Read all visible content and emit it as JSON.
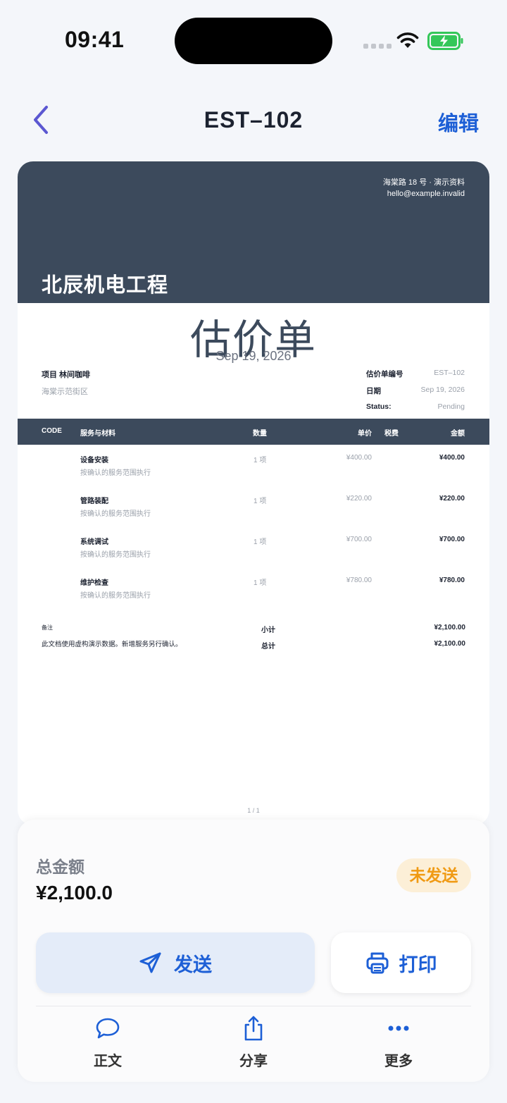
{
  "status": {
    "time": "09:41"
  },
  "nav": {
    "title": "EST–102",
    "edit_label": "编辑"
  },
  "document": {
    "address_line": "海棠路 18 号 · 演示资料",
    "email": "hello@example.invalid",
    "company": "北辰机电工程",
    "type_title": "估价单",
    "date": "Sep 19, 2026",
    "project_label": "项目 林间咖啡",
    "project_address": "海棠示范街区",
    "meta": [
      {
        "key": "估价单编号",
        "value": "EST–102"
      },
      {
        "key": "日期",
        "value": "Sep 19, 2026"
      },
      {
        "key": "Status:",
        "value": "Pending"
      }
    ],
    "columns": {
      "code": "CODE",
      "service": "服务与材料",
      "qty": "数量",
      "price": "单价",
      "tax": "税费",
      "amount": "金额"
    },
    "items": [
      {
        "name": "设备安装",
        "desc": "按确认的服务范围执行",
        "qty": "1 项",
        "price": "¥400.00",
        "amount": "¥400.00"
      },
      {
        "name": "管路装配",
        "desc": "按确认的服务范围执行",
        "qty": "1 项",
        "price": "¥220.00",
        "amount": "¥220.00"
      },
      {
        "name": "系统调试",
        "desc": "按确认的服务范围执行",
        "qty": "1 项",
        "price": "¥700.00",
        "amount": "¥700.00"
      },
      {
        "name": "维护检查",
        "desc": "按确认的服务范围执行",
        "qty": "1 项",
        "price": "¥780.00",
        "amount": "¥780.00"
      }
    ],
    "notes_label": "备注",
    "notes_text": "此文档使用虚构演示数据。新增服务另行确认。",
    "subtotal_label": "小计",
    "subtotal_value": "¥2,100.00",
    "total_label": "总计",
    "total_value": "¥2,100.00",
    "page": "1 / 1"
  },
  "panel": {
    "total_label": "总金额",
    "total_value": "¥2,100.0",
    "status_badge": "未发送",
    "send_label": "发送",
    "print_label": "打印",
    "tabs": [
      {
        "label": "正文",
        "icon": "chat-bubble-icon"
      },
      {
        "label": "分享",
        "icon": "share-icon"
      },
      {
        "label": "更多",
        "icon": "more-dots-icon"
      }
    ]
  },
  "colors": {
    "accent": "#1d5fd6",
    "header": "#3c4a5c",
    "badge_bg": "#fcefd7",
    "badge_text": "#f09a13"
  }
}
